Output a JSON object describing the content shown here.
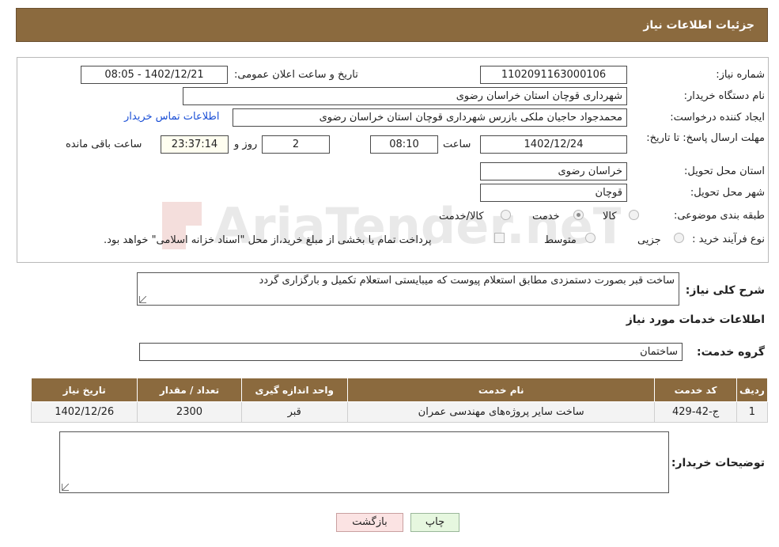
{
  "header": {
    "title": "جزئیات اطلاعات نیاز"
  },
  "form": {
    "need_number": {
      "label": "شماره نیاز:",
      "value": "1102091163000106"
    },
    "announce_datetime": {
      "label": "تاریخ و ساعت اعلان عمومی:",
      "value": "1402/12/21 - 08:05"
    },
    "buyer_org": {
      "label": "نام دستگاه خریدار:",
      "value": "شهرداری قوچان استان خراسان رضوی"
    },
    "requester": {
      "label": "ایجاد کننده درخواست:",
      "value": "محمدجواد حاجیان ملکی بازرس شهرداری قوچان استان خراسان رضوی"
    },
    "contact_link": "اطلاعات تماس خریدار",
    "deadline": {
      "label": "مهلت ارسال پاسخ: تا تاریخ:",
      "date": "1402/12/24",
      "time_label": "ساعت",
      "time": "08:10",
      "days": "2",
      "days_label": "روز و",
      "remaining": "23:37:14",
      "remaining_label": "ساعت باقی مانده"
    },
    "delivery_province": {
      "label": "استان محل تحویل:",
      "value": "خراسان رضوی"
    },
    "delivery_city": {
      "label": "شهر محل تحویل:",
      "value": "قوچان"
    },
    "category": {
      "label": "طبقه بندی موضوعی:",
      "options": [
        "کالا",
        "خدمت",
        "کالا/خدمت"
      ],
      "selected": "خدمت"
    },
    "purchase_process": {
      "label": "نوع فرآیند خرید :",
      "options": [
        "جزیی",
        "متوسط"
      ],
      "selected": "",
      "payment_note": "پرداخت تمام یا بخشی از مبلغ خرید،از محل \"اسناد خزانه اسلامی\" خواهد بود."
    }
  },
  "description": {
    "label": "شرح کلی نیاز:",
    "value": "ساخت قبر بصورت دستمزدی مطابق استعلام پیوست که میبایستی استعلام تکمیل و بارگزاری گردد"
  },
  "services": {
    "section_title": "اطلاعات خدمات مورد نیاز",
    "group_label": "گروه خدمت:",
    "group_value": "ساختمان",
    "table": {
      "headers": [
        "ردیف",
        "کد خدمت",
        "نام خدمت",
        "واحد اندازه گیری",
        "تعداد / مقدار",
        "تاریخ نیاز"
      ],
      "rows": [
        [
          "1",
          "ج-42-429",
          "ساخت سایر پروژه‌های مهندسی عمران",
          "قبر",
          "2300",
          "1402/12/26"
        ]
      ]
    }
  },
  "buyer_notes": {
    "label": "توضیحات خریدار:",
    "value": ""
  },
  "buttons": {
    "print": "چاپ",
    "back": "بازگشت"
  },
  "watermark": {
    "text": "AriaTender.neT"
  },
  "colors": {
    "header_bg": "#8b6a3e",
    "link": "#1a4fd6",
    "print_btn": "#e6f7df",
    "back_btn": "#fbe3e3"
  }
}
